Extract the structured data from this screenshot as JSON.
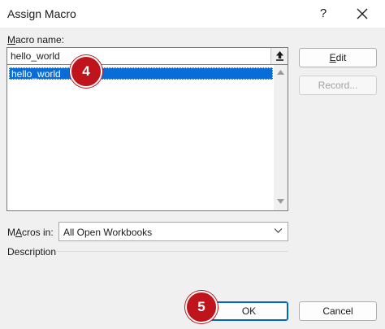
{
  "window": {
    "title": "Assign Macro",
    "help_label": "?"
  },
  "macro_name": {
    "label_underlined": "M",
    "label_rest": "acro name:",
    "value": "hello_world"
  },
  "macro_list": {
    "items": [
      {
        "label": "hello_world",
        "selected": true
      }
    ]
  },
  "buttons": {
    "edit_underlined": "E",
    "edit_rest": "dit",
    "record": "Record...",
    "ok": "OK",
    "cancel": "Cancel"
  },
  "macros_in": {
    "label_underlined": "A",
    "label_pre": "M",
    "label_rest": "cros in:",
    "selected": "All Open Workbooks"
  },
  "description": {
    "label": "Description"
  },
  "callouts": {
    "step_4": "4",
    "step_5": "5"
  },
  "colors": {
    "selection": "#0a6cd6",
    "callout": "#c0141c",
    "primary_border": "#0067c0"
  }
}
